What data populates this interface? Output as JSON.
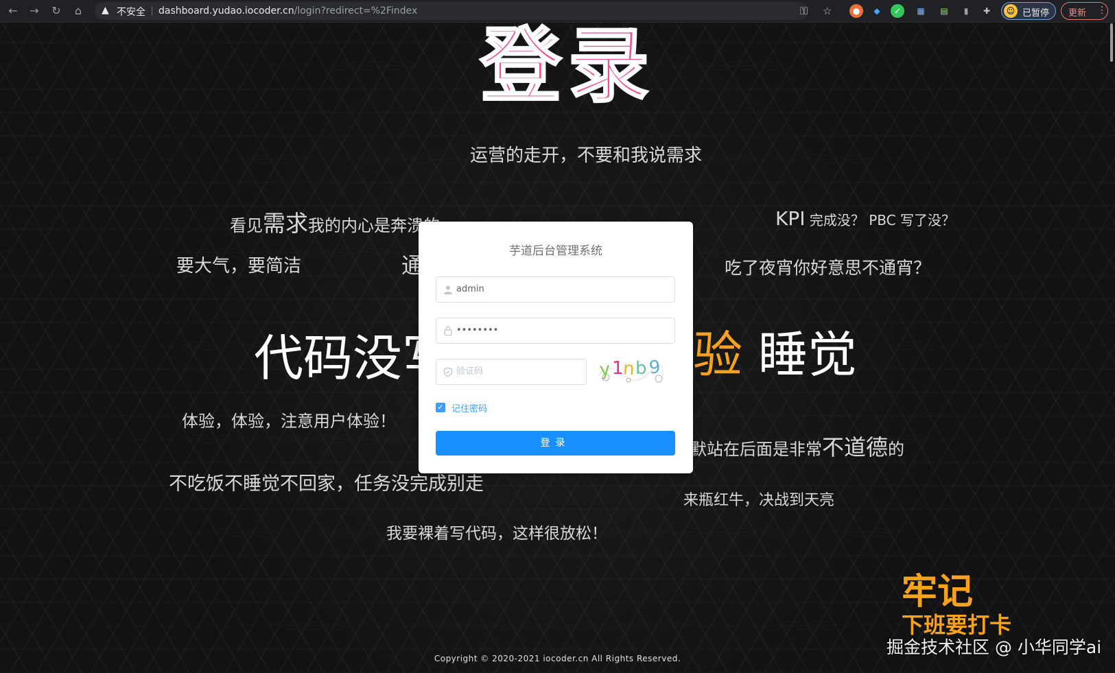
{
  "browser": {
    "back_icon": "←",
    "forward_icon": "→",
    "reload_icon": "↻",
    "home_icon": "⌂",
    "warning_icon": "▲",
    "insecure_label": "不安全",
    "url_host": "dashboard.yudao.iocoder.cn",
    "url_path": "/login?redirect=%2Findex",
    "key_icon": "⚿",
    "star_icon": "☆",
    "extensions_icon": "✚",
    "profile_label": "已暂停",
    "update_label": "更新",
    "menu_icon": "⋮"
  },
  "page": {
    "big_title": "登录",
    "bg_phrases": {
      "p1": "运营的走开，不要和我说需求",
      "p2a": "看见",
      "p2b": "需求",
      "p2c": "我的内心是奔溃的",
      "p3a": "KPI",
      "p3b": " 完成没？ PBC 写了没？",
      "p4": "要大气，要简洁",
      "p5": "通",
      "p6": "吃了夜宵你好意思不通宵？",
      "p7": "代码没写",
      "p8a": "验",
      "p8b": " 睡觉",
      "p9": "体验，体验，注意用户体验！",
      "p10a": "默站在后面是非常",
      "p10b": "不道德",
      "p10c": "的",
      "p11": "不吃饭不睡觉不回家，任务没完成别走",
      "p12": "来瓶红牛，决战到天亮",
      "p13": "我要裸着写代码，这样很放松！"
    },
    "note_title": "牢记",
    "note_sub": "下班要打卡",
    "watermark": "掘金技术社区 @ 小华同学ai",
    "copyright": "Copyright © 2020-2021 iocoder.cn All Rights Reserved."
  },
  "login": {
    "title": "芋道后台管理系统",
    "username_value": "admin",
    "password_value": "••••••••",
    "captcha_placeholder": "验证码",
    "captcha_text": "y1nb9",
    "remember_label": "记住密码",
    "remember_checked": true,
    "submit_label": "登录"
  },
  "colors": {
    "accent": "#1890ff",
    "title_pink": "#f2518f",
    "orange": "#f6a21d"
  }
}
